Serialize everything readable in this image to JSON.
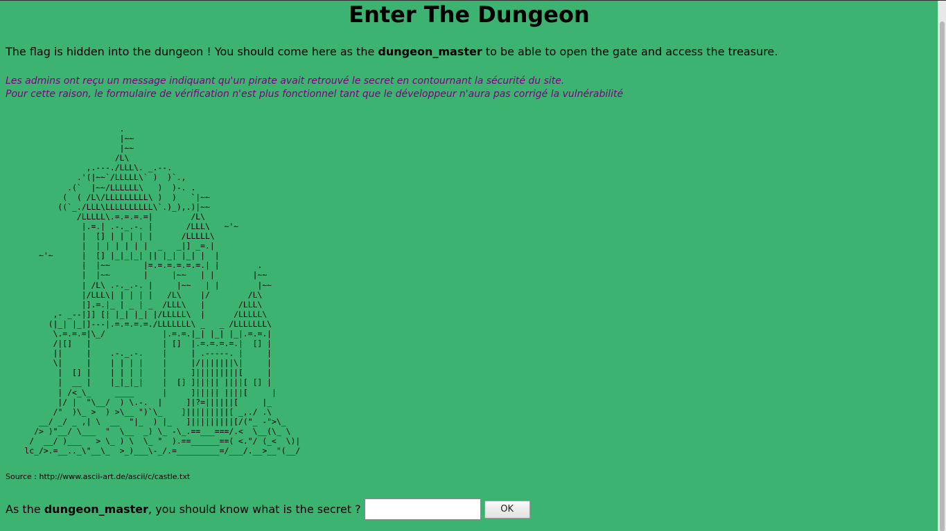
{
  "page": {
    "title": "Enter The Dungeon",
    "intro": {
      "before": "The flag is hidden into the dungeon ! You should come here as the ",
      "strong": "dungeon_master",
      "after": " to be able to open the gate and access the treasure."
    },
    "notice": {
      "line1": "Les admins ont reçu un message indiquant qu'un pirate avait retrouvé le secret en contournant la sécurité du site.",
      "line2": "Pour cette raison, le formulaire de vérification n'est plus fonctionnel tant que le développeur n'aura pas corrigé la vulnérabilité"
    },
    "ascii_art": "                        .\n                        |~~\n                        |~~\n                       /L\\\n                 ,.---./LLL\\. _.--.\n               .'(|~~`/LLLLL\\` )  )`.,\n             .(`  |~~/LLLLLL\\   )  )-. .\n            (  ( /L\\/LLLLLLLLL\\ )  )   `|~~\n           ((`_./LLL\\LLLLLLLLLL\\`.)_),.)|~~\n               /LLLLL\\.=.=.=.=|        /L\\\n                |.=.| .-._.-. |       /LLL\\   ~'~\n                |  [] | | | | |      /LLLLL\\\n                |  | | | | | |  _   _|] _=.|\n       ~'~      |  [] |_|_|_| || |_| |_| |  |\n                |  |~~       |=.=.=.=.=.=.| |        .\n                |  |~~       |     |~~   | |        |~~\n                | /L\\ .-._.-. |     |~~   | |        |~~\n                |/LLL\\| | | | |   /L\\    |/        /L\\\n                |].=.|_ | _ | _  /LLL\\   |       /LLL\\\n          ,- _--|]] [| |_| |_| |/LLLLL\\  |      /LLLLL\\\n         (|_| |_|]---|.=.=.=.=./LLLLLLL\\ _   _ /LLLLLLL\\\n          \\.=.=.=|\\_/            |.=.=.|_| |_| |_|.=.=.|\n          /|[]   |               | []  |.=.=.=.=.|  [] |\n          ||     |    .-._.-.    |     | .-----. |     |\n          \\|     |    | | | |    |     |/|||||||\\|     |\n           |  [] |    | | | |    |     ]|||||||||[     |\n           |  __ |    |_|_|_|    |  [] ]||||| ||||[ [] |\n           | /<_\\_     ____      |     ]||||| ||||[     |\n           |/ |  \"\\__/  ) \\.-.  |     ]|?=||||||[     |_\n          /\"  )\\_ >  ) >\\__ \")`\\_    ]|||||||||[ _,./ .\\\n       __/ _/ _ ,| \\  __  \"|_  ) |_   ]|||||||||[/(\"_ -\">\\_\n      /> )\"__/ \\___  \"  \\__  _) \\_ -\\_.==___===/.<  \\__(\\_ \\\n     /  __/ )___   > \\_ ) \\  \\_ \"  ).==______==( <.\"/ (_<  \\)|\n    lc_/>.=__.._\\\"__\\_  >_)___\\-_/.=_________=/___/.__>__\"(__/",
    "source": "Source : http://www.ascii-art.de/ascii/c/castle.txt",
    "form": {
      "prompt_before": "As the ",
      "prompt_strong": "dungeon_master",
      "prompt_after": ", you should know what is the secret ?",
      "input_value": "",
      "submit_label": "OK"
    }
  },
  "colors": {
    "background": "#3cb371",
    "notice_text": "#800080"
  }
}
